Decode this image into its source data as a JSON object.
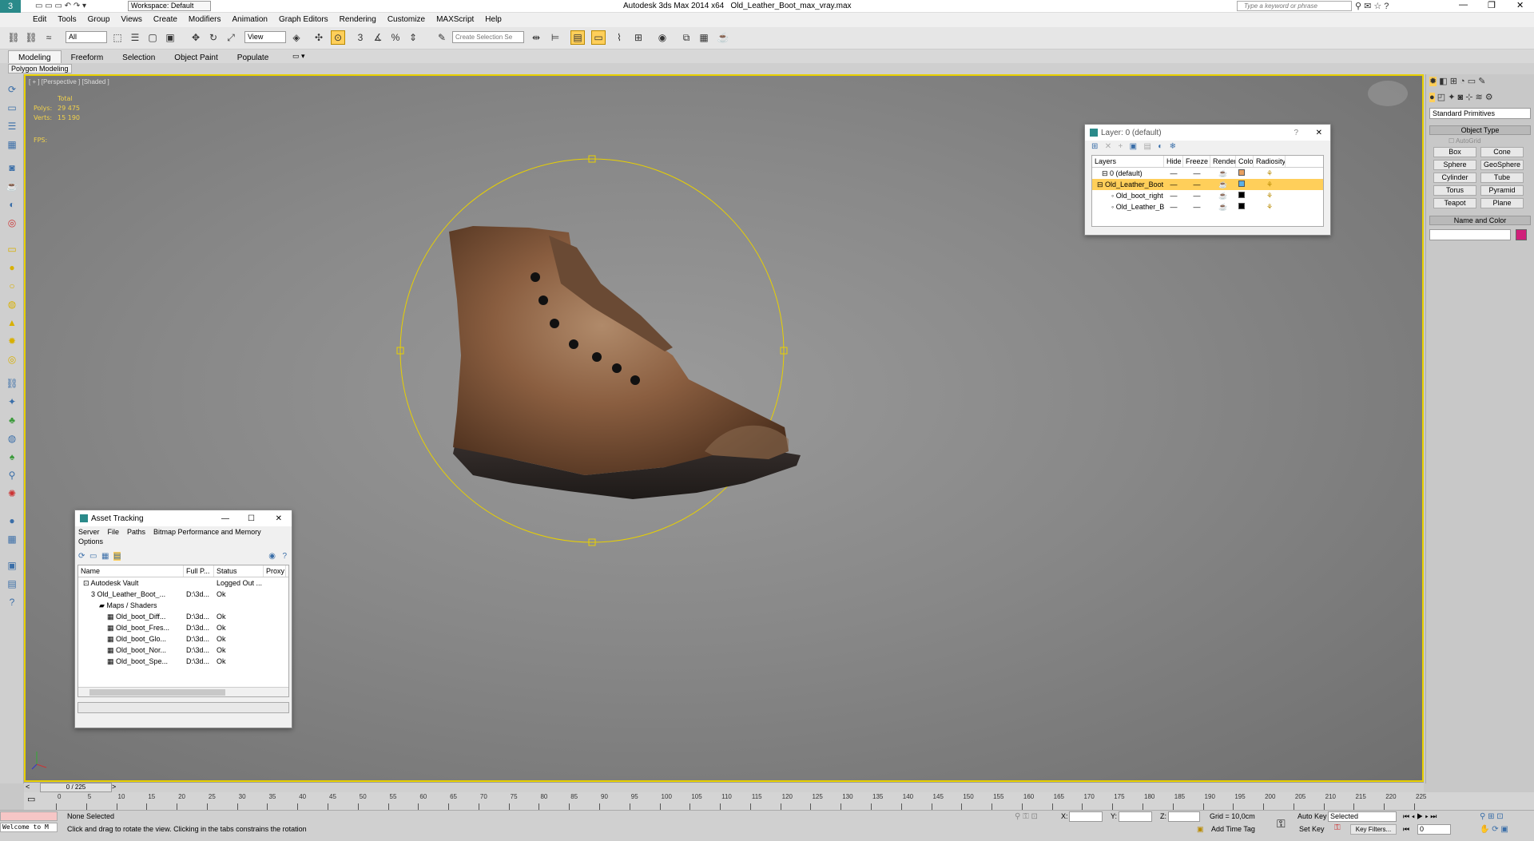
{
  "app": {
    "title": "Autodesk 3ds Max  2014 x64",
    "file": "Old_Leather_Boot_max_vray.max",
    "workspace": "Workspace: Default",
    "search_placeholder": "Type a keyword or phrase"
  },
  "menu": [
    "Edit",
    "Tools",
    "Group",
    "Views",
    "Create",
    "Modifiers",
    "Animation",
    "Graph Editors",
    "Rendering",
    "Customize",
    "MAXScript",
    "Help"
  ],
  "toolbar": {
    "filter": "All",
    "refcoord": "View",
    "selection_set": "Create Selection Se"
  },
  "ribbon": {
    "tabs": [
      "Modeling",
      "Freeform",
      "Selection",
      "Object Paint",
      "Populate"
    ],
    "subtab": "Polygon Modeling"
  },
  "viewport": {
    "label": "[ + ] [Perspective ] [Shaded ]",
    "stats_header": "Total",
    "polys_label": "Polys:",
    "polys_value": "29 475",
    "verts_label": "Verts:",
    "verts_value": "15 190",
    "fps_label": "FPS:",
    "colors": {
      "selection": "#e8d000",
      "stats": "#f2d24a"
    }
  },
  "layer_dialog": {
    "title": "Layer: 0 (default)",
    "columns": [
      "Layers",
      "Hide",
      "Freeze",
      "Render",
      "Color",
      "Radiosity"
    ],
    "rows": [
      {
        "name": "0 (default)",
        "hide": "—",
        "freeze": "—",
        "color": "#e8a060"
      },
      {
        "name": "Old_Leather_Boot",
        "hide": "—",
        "freeze": "—",
        "color": "#5ab0e8"
      },
      {
        "name": "Old_boot_right",
        "hide": "—",
        "freeze": "—",
        "color": "#000000"
      },
      {
        "name": "Old_Leather_Bo",
        "hide": "—",
        "freeze": "—",
        "color": "#000000"
      }
    ]
  },
  "asset_tracking": {
    "title": "Asset Tracking",
    "menu": [
      "Server",
      "File",
      "Paths",
      "Bitmap Performance and Memory"
    ],
    "menu2": "Options",
    "columns": [
      "Name",
      "Full P...",
      "Status",
      "Proxy R"
    ],
    "rows": [
      {
        "name": "Autodesk Vault",
        "path": "",
        "status": "Logged Out ...",
        "indent": 0
      },
      {
        "name": "Old_Leather_Boot_...",
        "path": "D:\\3d...",
        "status": "Ok",
        "indent": 1
      },
      {
        "name": "Maps / Shaders",
        "path": "",
        "status": "",
        "indent": 2
      },
      {
        "name": "Old_boot_Diff...",
        "path": "D:\\3d...",
        "status": "Ok",
        "indent": 3
      },
      {
        "name": "Old_boot_Fres...",
        "path": "D:\\3d...",
        "status": "Ok",
        "indent": 3
      },
      {
        "name": "Old_boot_Glo...",
        "path": "D:\\3d...",
        "status": "Ok",
        "indent": 3
      },
      {
        "name": "Old_boot_Nor...",
        "path": "D:\\3d...",
        "status": "Ok",
        "indent": 3
      },
      {
        "name": "Old_boot_Spe...",
        "path": "D:\\3d...",
        "status": "Ok",
        "indent": 3
      }
    ]
  },
  "command_panel": {
    "dropdown": "Standard Primitives",
    "object_type_header": "Object Type",
    "autogrid": "AutoGrid",
    "buttons": [
      [
        "Box",
        "Cone"
      ],
      [
        "Sphere",
        "GeoSphere"
      ],
      [
        "Cylinder",
        "Tube"
      ],
      [
        "Torus",
        "Pyramid"
      ],
      [
        "Teapot",
        "Plane"
      ]
    ],
    "name_color_header": "Name and Color",
    "swatch_color": "#d0207a"
  },
  "timeline": {
    "frame": "0 / 225",
    "ticks": [
      "0",
      "5",
      "10",
      "15",
      "20",
      "25",
      "30",
      "35",
      "40",
      "45",
      "50",
      "55",
      "60",
      "65",
      "70",
      "75",
      "80",
      "85",
      "90",
      "95",
      "100",
      "105",
      "110",
      "115",
      "120",
      "125",
      "130",
      "135",
      "140",
      "145",
      "150",
      "155",
      "160",
      "165",
      "170",
      "175",
      "180",
      "185",
      "190",
      "195",
      "200",
      "205",
      "210",
      "215",
      "220",
      "225"
    ]
  },
  "status": {
    "welcome": "Welcome to M",
    "selection": "None Selected",
    "prompt": "Click and drag to rotate the view.  Clicking in the tabs constrains the rotation",
    "x_label": "X:",
    "y_label": "Y:",
    "z_label": "Z:",
    "grid": "Grid = 10,0cm",
    "add_time_tag": "Add Time Tag",
    "auto_key": "Auto Key",
    "set_key": "Set Key",
    "selected": "Selected",
    "key_filters": "Key Filters...",
    "frame_value": "0"
  }
}
